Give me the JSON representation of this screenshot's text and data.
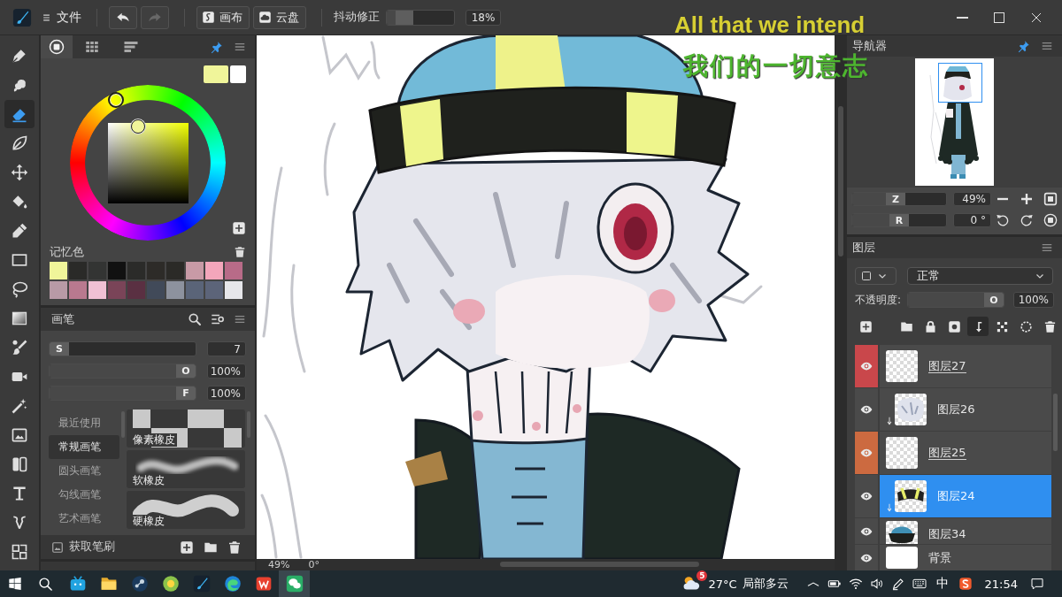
{
  "title_bar": {
    "file_menu": "文件",
    "history": [
      {
        "kind": "undo",
        "disabled": false
      },
      {
        "kind": "redo",
        "disabled": true
      }
    ],
    "buttons": [
      {
        "kind": "canvas",
        "label": "画布"
      },
      {
        "kind": "cloud",
        "label": "云盘"
      }
    ],
    "stabilizer": {
      "label": "抖动修正",
      "level": 0.18,
      "reading": "18%"
    }
  },
  "caption": [
    "All that we intend",
    "我们的一切意志"
  ],
  "toolbar": {
    "tools": [
      {
        "kind": "pen",
        "selected": false
      },
      {
        "kind": "smudge",
        "selected": false
      },
      {
        "kind": "eraser",
        "selected": true
      },
      {
        "kind": "blur",
        "selected": false
      },
      {
        "kind": "move",
        "selected": false
      },
      {
        "kind": "fill",
        "selected": false
      },
      {
        "kind": "eyedropper",
        "selected": false
      },
      {
        "kind": "select",
        "selected": false
      },
      {
        "kind": "lasso",
        "selected": false
      },
      {
        "kind": "gradient",
        "selected": false
      },
      {
        "kind": "brush",
        "selected": false
      },
      {
        "kind": "record",
        "selected": false
      },
      {
        "kind": "wand",
        "selected": false
      },
      {
        "kind": "import",
        "selected": false
      },
      {
        "kind": "panels",
        "selected": false
      },
      {
        "kind": "text",
        "selected": false
      },
      {
        "kind": "symmetry",
        "selected": false
      },
      {
        "kind": "frame",
        "selected": false
      }
    ]
  },
  "color_panel": {
    "tabs": [
      {
        "kind": "wheel",
        "selected": true
      },
      {
        "kind": "grid",
        "selected": false
      },
      {
        "kind": "sliders",
        "selected": false
      }
    ],
    "current_colors": [
      {
        "color": "#f0f59a"
      },
      {
        "color": "#ffffff"
      }
    ],
    "memory_label": "记忆色",
    "memory_colors": [
      {
        "color": "#f0f59a"
      },
      {
        "color": "#2a2a28"
      },
      {
        "color": "#333433"
      },
      {
        "color": "#111111"
      },
      {
        "color": "#2b2b29"
      },
      {
        "color": "#2d2b28"
      },
      {
        "color": "#2b2a27"
      },
      {
        "color": "#c89aa6"
      },
      {
        "color": "#f3a6bb"
      },
      {
        "color": "#b86b88"
      },
      {
        "color": "#b89aa6"
      },
      {
        "color": "#b9798f"
      },
      {
        "color": "#f0c0d4"
      },
      {
        "color": "#7a4458"
      },
      {
        "color": "#5a3042"
      },
      {
        "color": "#414a59"
      },
      {
        "color": "#8d929e"
      },
      {
        "color": "#5a6478"
      },
      {
        "color": "#5c6479"
      },
      {
        "color": "#e6e6ea"
      }
    ]
  },
  "brush_panel": {
    "title": "画笔",
    "sliders": [
      {
        "key": "S",
        "level": 0.0,
        "reading": "7"
      },
      {
        "key": "O",
        "level": 1,
        "reading": "100%"
      },
      {
        "key": "F",
        "level": 1,
        "reading": "100%"
      }
    ],
    "categories": [
      {
        "label": "最近使用",
        "selected": false
      },
      {
        "label": "常规画笔",
        "selected": true
      },
      {
        "label": "圆头画笔",
        "selected": false
      },
      {
        "label": "勾线画笔",
        "selected": false
      },
      {
        "label": "艺术画笔",
        "selected": false
      }
    ],
    "brushes": [
      {
        "kind": "pixel",
        "label": "像素橡皮"
      },
      {
        "kind": "soft",
        "label": "软橡皮"
      },
      {
        "kind": "hard",
        "label": "硬橡皮"
      }
    ],
    "footer": "获取笔刷"
  },
  "canvas": {
    "zoom": "49%",
    "rotation": "0°"
  },
  "navigator": {
    "title": "导航器",
    "zoom": {
      "key": "Z",
      "level": 0.45,
      "reading": "49%"
    },
    "rotation": {
      "key": "R",
      "level": 0.5,
      "reading": "0 °"
    }
  },
  "layers": {
    "title": "图层",
    "blend_mode": "正常",
    "opacity": {
      "label": "不透明度:",
      "key": "O",
      "level": 1,
      "reading": "100%"
    },
    "tools": [
      {
        "kind": "add",
        "selected": false
      },
      {
        "kind": "folder",
        "selected": false
      },
      {
        "kind": "lock",
        "selected": false
      },
      {
        "kind": "mask",
        "selected": false
      },
      {
        "kind": "clip",
        "selected": true
      },
      {
        "kind": "transform",
        "selected": false
      },
      {
        "kind": "select",
        "selected": false
      },
      {
        "kind": "delete",
        "selected": false
      }
    ],
    "layers": [
      {
        "name": "图层27",
        "kind": "empty",
        "color": "#c9474b",
        "underlined": true,
        "clipped": false,
        "selected": false
      },
      {
        "name": "图层26",
        "kind": "hair",
        "underlined": false,
        "clipped": true,
        "selected": false
      },
      {
        "name": "图层25",
        "kind": "empty",
        "color": "#cc6a40",
        "underlined": true,
        "clipped": false,
        "selected": false
      },
      {
        "name": "图层24",
        "kind": "band",
        "underlined": false,
        "clipped": true,
        "selected": true
      },
      {
        "name": "图层34",
        "kind": "hat",
        "underlined": false,
        "clipped": false,
        "selected": false
      }
    ],
    "background": {
      "name": "背景"
    }
  },
  "taskbar": {
    "apps": [
      {
        "kind": "tv",
        "active": false
      },
      {
        "kind": "folder",
        "active": false
      },
      {
        "kind": "disc",
        "active": false
      },
      {
        "kind": "orb",
        "active": false
      },
      {
        "kind": "brush",
        "active": false
      },
      {
        "kind": "swirl",
        "active": false
      },
      {
        "kind": "red",
        "active": false
      },
      {
        "kind": "chat",
        "active": true
      }
    ],
    "weather": {
      "badge": "5",
      "temperature": "27°C",
      "condition": "局部多云"
    },
    "input_method": "中",
    "time": "21:54"
  }
}
